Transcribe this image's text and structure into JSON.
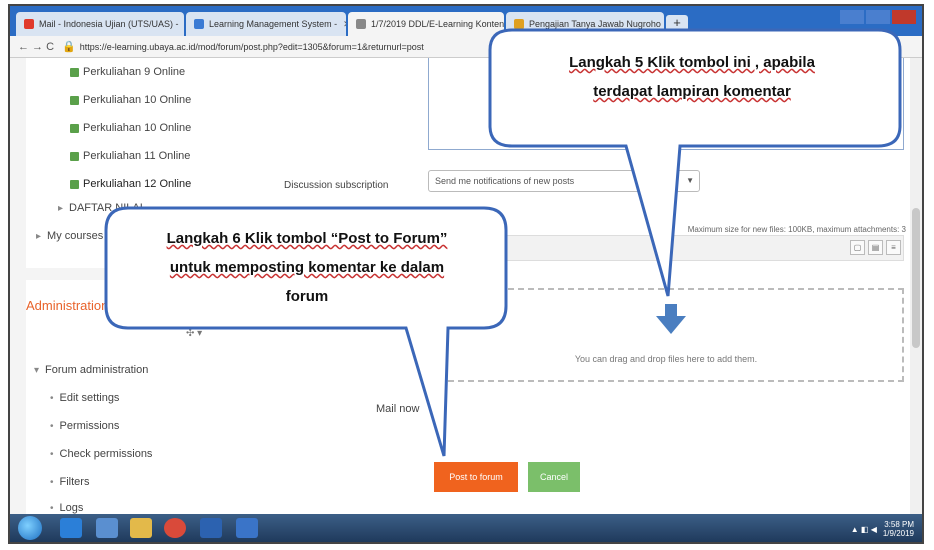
{
  "browser": {
    "tabs": [
      {
        "label": "Mail - Indonesia Ujian (UTS/UAS) -",
        "color": "#e03a2c"
      },
      {
        "label": "Learning Management System -",
        "color": "#3b7bd4"
      },
      {
        "label": "1/7/2019 DDL/E-Learning Konten",
        "color": "#888888"
      },
      {
        "label": "Pengajian Tanya Jawab Nugroho",
        "color": "#e0a020"
      }
    ],
    "nav": "← → C",
    "url": "https://e-learning.ubaya.ac.id/mod/forum/post.php?edit=1305&forum=1&returnurl=post"
  },
  "sidebar": {
    "items": [
      {
        "label": "Perkuliahan 9 Online"
      },
      {
        "label": "Perkuliahan 10 Online"
      },
      {
        "label": "Perkuliahan 10 Online"
      },
      {
        "label": "Perkuliahan 11 Online"
      },
      {
        "label": "Perkuliahan 12 Online"
      }
    ],
    "daftar": "DAFTAR NILAI",
    "mycourses": "My courses",
    "admin_title": "Administration",
    "admin_items": [
      {
        "label": "Forum administration"
      },
      {
        "label": "Edit settings"
      },
      {
        "label": "Permissions"
      },
      {
        "label": "Check permissions"
      },
      {
        "label": "Filters"
      },
      {
        "label": "Logs"
      }
    ]
  },
  "form": {
    "subscription_label": "Discussion subscription",
    "subscription_value": "Send me notifications of new posts",
    "maxsize": "Maximum size for new files: 100KB, maximum attachments: 3",
    "drop_text": "You can drag and drop files here to add them.",
    "mailnow": "Mail now",
    "post_button": "Post to forum",
    "cancel_button": "Cancel"
  },
  "callouts": {
    "step5_line1": "Langkah 5 Klik tombol ini , apabila",
    "step5_line2": "terdapat lampiran komentar",
    "step6_line1": "Langkah 6 Klik tombol “Post to Forum”",
    "step6_line2": "untuk memposting komentar ke dalam",
    "step6_line3": "forum"
  },
  "taskbar": {
    "time": "3:58 PM",
    "date": "1/9/2019"
  },
  "colors": {
    "accent_orange": "#f0631e",
    "cancel_green": "#7bbf6a",
    "callout_border": "#3b67b8"
  }
}
